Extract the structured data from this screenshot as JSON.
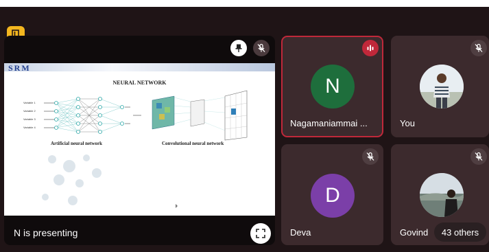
{
  "meeting": {
    "presentation": {
      "presenting_label": "N is presenting",
      "slide": {
        "logo_text": "SRM",
        "title": "NEURAL NETWORK",
        "caption_left": "Artificial neural network",
        "caption_right": "Convolutional neural network",
        "input_labels": [
          "Variable 1",
          "Variable 2",
          "Variable 3",
          "Variable 4"
        ]
      }
    },
    "participants": [
      {
        "name": "Nagamaniammai ...",
        "initial": "N",
        "avatar_color": "#1e6e3c"
      },
      {
        "name": "You",
        "initial": ""
      },
      {
        "name": "Deva",
        "initial": "D",
        "avatar_color": "#7b3fa8"
      },
      {
        "name": "Govind",
        "initial": ""
      }
    ],
    "others_label": "43 others",
    "colors": {
      "speaking_border": "#c0283a",
      "tile_bg": "#3c2a2d",
      "app_icon": "#f3b61f"
    }
  }
}
